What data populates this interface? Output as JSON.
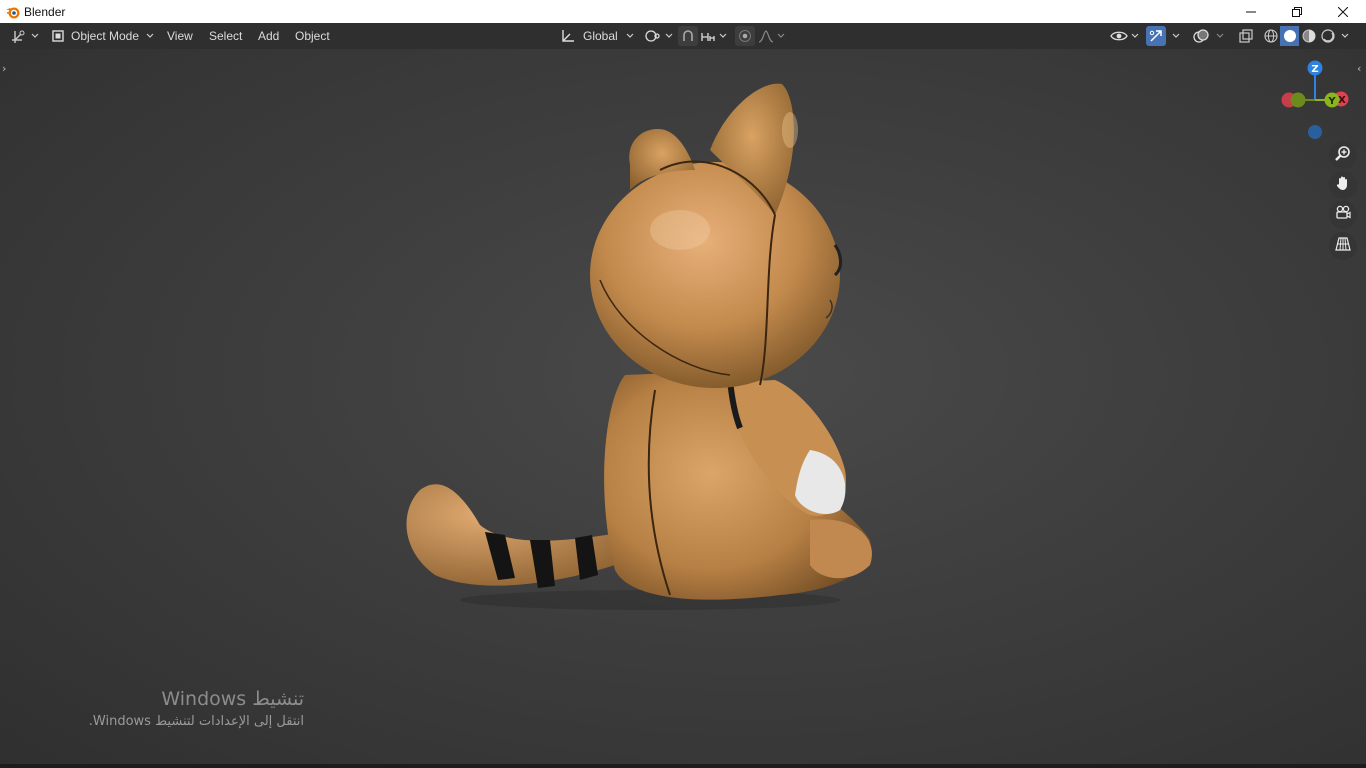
{
  "window": {
    "title": "Blender",
    "icons": [
      "blender-logo-icon",
      "minimize-icon",
      "restore-icon",
      "close-icon"
    ]
  },
  "header": {
    "editor_type_icon": "editor-type-icon",
    "mode_label": "Object Mode",
    "menus": [
      "View",
      "Select",
      "Add",
      "Object"
    ],
    "transform_orientation": "Global",
    "pivot_icon": "pivot-point-icon",
    "snap_icon": "snap-icon",
    "snap_target_icon": "snap-increment-icon",
    "proportional_icon": "proportional-edit-icon",
    "falloff_icon": "falloff-curve-icon",
    "visibility_icon": "eye-visibility-icon",
    "gizmo_icon": "gizmo-toggle-icon",
    "overlay_icon": "overlay-icon",
    "xray_icon": "xray-toggle-icon",
    "shading_modes": [
      "wireframe-icon",
      "solid-icon",
      "material-preview-icon",
      "rendered-icon"
    ],
    "active_shading": "solid"
  },
  "gizmo": {
    "axes": {
      "z": "Z",
      "y": "Y",
      "x": "X"
    },
    "colors": {
      "x": "#e0404f",
      "y": "#8ab51f",
      "z": "#2f83e0"
    }
  },
  "nav_buttons": [
    "zoom-icon",
    "pan-hand-icon",
    "camera-view-icon",
    "ortho-grid-icon"
  ],
  "watermark": {
    "title": "تنشيط Windows",
    "subtitle": "انتقل إلى الإعدادات لتنشيط Windows."
  },
  "colors": {
    "header_bg": "#2f2f2f",
    "active_blue": "#4772b3",
    "viewport_bg": "#3f3f3f",
    "cat_body": "#c18b4f"
  }
}
